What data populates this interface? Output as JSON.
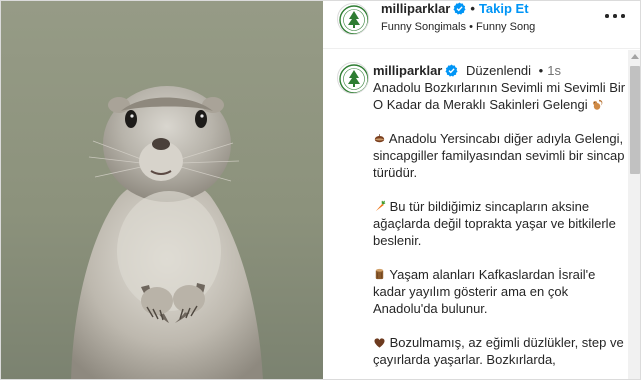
{
  "header": {
    "username": "milliparklar",
    "follow_label": "Takip Et",
    "audio_artist": "Funny Songimals",
    "audio_title": "Funny Song"
  },
  "caption": {
    "username": "milliparklar",
    "edited_label": "Düzenlendi",
    "time_ago": "1s",
    "paragraphs": [
      "Anadolu Bozkırlarının Sevimli mi Sevimli Bir O Kadar da Meraklı Sakinleri Gelengi",
      "Anadolu Yersincabı diğer adıyla Gelengi, sincapgiller familyasından sevimli bir sincap türüdür.",
      "Bu tür bildiğimiz sincapların aksine ağaçlarda değil toprakta yaşar ve bitkilerle beslenir.",
      "Yaşam alanları Kafkaslardan İsrail'e kadar yayılım gösterir ama en çok Anadolu'da bulunur.",
      "Bozulmamış, az eğimli düzlükler, step ve çayırlarda yaşarlar. Bozkırlarda,"
    ],
    "emojis": [
      "squirrel-emoji",
      "chestnut-emoji",
      "carrot-emoji",
      "log-emoji",
      "brown-heart-emoji"
    ]
  },
  "colors": {
    "link_blue": "#0095f6",
    "verified_blue": "#0095f6",
    "text": "#262626",
    "muted": "#737373",
    "border": "#dbdbdb",
    "logo_green": "#2e7d32"
  }
}
